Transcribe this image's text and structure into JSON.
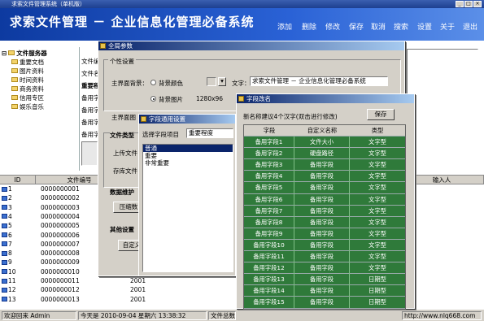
{
  "titlebar": {
    "title": "求索文件管理系统（单机版）"
  },
  "header": {
    "app_title": "求索文件管理 － 企业信息化管理必备系统",
    "menu": [
      "添加",
      "删除",
      "修改",
      "保存",
      "取消",
      "搜索",
      "设置",
      "关于",
      "退出"
    ]
  },
  "tree": {
    "root": "文件服务器",
    "items": [
      "重要文档",
      "图片资料",
      "时间资料",
      "商务资料",
      "信用专区",
      "娱乐音乐"
    ]
  },
  "detail_labels": [
    "文件编",
    "文件名",
    "重要程",
    "备用字",
    "备用字",
    "备用字",
    "备用字"
  ],
  "grid": {
    "columns": [
      "ID",
      "文件编号",
      "",
      "输入人"
    ],
    "rows": [
      {
        "id": "1",
        "code": "0000000001",
        "x": ""
      },
      {
        "id": "2",
        "code": "0000000002",
        "x": ""
      },
      {
        "id": "3",
        "code": "0000000003",
        "x": ""
      },
      {
        "id": "4",
        "code": "0000000004",
        "x": ""
      },
      {
        "id": "5",
        "code": "0000000005",
        "x": ""
      },
      {
        "id": "6",
        "code": "0000000006",
        "x": ""
      },
      {
        "id": "7",
        "code": "0000000007",
        "x": ""
      },
      {
        "id": "8",
        "code": "0000000008",
        "x": ""
      },
      {
        "id": "9",
        "code": "0000000009",
        "x": ""
      },
      {
        "id": "10",
        "code": "0000000010",
        "x": "2001"
      },
      {
        "id": "11",
        "code": "0000000011",
        "x": "2001"
      },
      {
        "id": "12",
        "code": "0000000012",
        "x": "2001"
      },
      {
        "id": "13",
        "code": "0000000013",
        "x": "2001"
      }
    ]
  },
  "status": {
    "user": "欢迎回来 Admin",
    "today": "今天是 2010-09-04 星期六 13:38:32",
    "files": "文件总数",
    "site": "http://www.nlq668.com"
  },
  "global_params": {
    "title": "全局参数",
    "section_params": "个性设置",
    "main_bg_label": "主界面背景：",
    "bg_color_label": "背景颜色",
    "bg_image_label": "背景图片",
    "image_size": "1280x96",
    "text_label": "文字：",
    "text_value": "求索文件管理 － 企业信息化管理必备系统",
    "main_icon_label": "主界面图",
    "file_type_section": "文件类型",
    "upload_label": "上传文件",
    "store_label": "存库文件",
    "maintenance_section": "数据维护",
    "compress_button": "压缩数",
    "other_section": "其他设置",
    "custom_button": "自定义"
  },
  "common_items": {
    "title": "字段通用设置",
    "select_label": "选择字段项目",
    "select_value": "重要程度",
    "options": [
      "普通",
      "重要",
      "非常重要"
    ],
    "selected_index": 0
  },
  "field_rename": {
    "title": "字段改名",
    "note": "新名称建议4个汉字(双击进行修改)",
    "save_button": "保存",
    "columns": [
      "字段",
      "自定义名称",
      "类型"
    ],
    "rows": [
      [
        "备用字段1",
        "文件大小",
        "文字型"
      ],
      [
        "备用字段2",
        "硬盘路径",
        "文字型"
      ],
      [
        "备用字段3",
        "备用字段",
        "文字型"
      ],
      [
        "备用字段4",
        "备用字段",
        "文字型"
      ],
      [
        "备用字段5",
        "备用字段",
        "文字型"
      ],
      [
        "备用字段6",
        "备用字段",
        "文字型"
      ],
      [
        "备用字段7",
        "备用字段",
        "文字型"
      ],
      [
        "备用字段8",
        "备用字段",
        "文字型"
      ],
      [
        "备用字段9",
        "备用字段",
        "文字型"
      ],
      [
        "备用字段10",
        "备用字段",
        "文字型"
      ],
      [
        "备用字段11",
        "备用字段",
        "文字型"
      ],
      [
        "备用字段12",
        "备用字段",
        "文字型"
      ],
      [
        "备用字段13",
        "备用字段",
        "日期型"
      ],
      [
        "备用字段14",
        "备用字段",
        "日期型"
      ],
      [
        "备用字段15",
        "备用字段",
        "日期型"
      ]
    ]
  },
  "colors": {
    "banner": "#1d4fc0",
    "table_body": "#2f7a3a",
    "dialog_title": "#0a246a"
  }
}
